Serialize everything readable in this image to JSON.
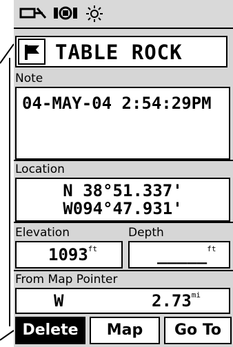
{
  "status": {
    "battery_icon": "battery-icon",
    "satellite_icon": "gps-signal-icon",
    "backlight_icon": "backlight-icon"
  },
  "waypoint": {
    "symbol_icon": "flag-icon",
    "name": "TABLE ROCK"
  },
  "note": {
    "label": "Note",
    "value": "04-MAY-04 2:54:29PM"
  },
  "location": {
    "label": "Location",
    "lat": "N  38°51.337'",
    "lon": "W094°47.931'"
  },
  "elevation": {
    "label": "Elevation",
    "value": "1093",
    "unit": "ft"
  },
  "depth": {
    "label": "Depth",
    "value": "_____",
    "unit": "ft"
  },
  "from_pointer": {
    "label": "From Map Pointer",
    "bearing": "W",
    "distance": "2.73",
    "unit": "mi"
  },
  "buttons": {
    "delete": "Delete",
    "map": "Map",
    "goto": "Go To"
  }
}
